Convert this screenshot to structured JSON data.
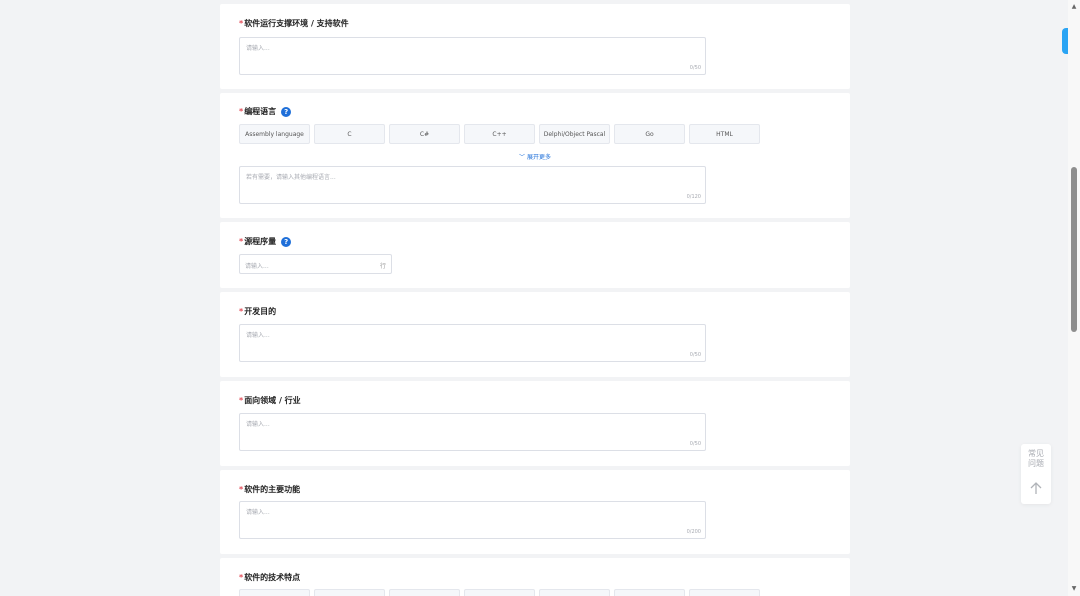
{
  "sections": {
    "env": {
      "title": "软件运行支撑环境 / 支持软件",
      "placeholder": "请输入...",
      "count": "0/50"
    },
    "lang": {
      "title": "编程语言",
      "help": "?",
      "options": [
        "Assembly language",
        "C",
        "C#",
        "C++",
        "Delphi/Object Pascal",
        "Go",
        "HTML"
      ],
      "expand": "展开更多",
      "placeholder": "若有需要，请输入其他编程语言...",
      "count": "0/120"
    },
    "loc": {
      "title": "源程序量",
      "help": "?",
      "placeholder": "请输入...",
      "unit": "行"
    },
    "purpose": {
      "title": "开发目的",
      "placeholder": "请输入...",
      "count": "0/50"
    },
    "domain": {
      "title": "面向领域 / 行业",
      "placeholder": "请输入...",
      "count": "0/50"
    },
    "features": {
      "title": "软件的主要功能",
      "placeholder": "请输入...",
      "count": "0/200"
    },
    "tech": {
      "title": "软件的技术特点"
    }
  },
  "required_mark": "*",
  "float": {
    "faq_line1": "常见",
    "faq_line2": "问题"
  },
  "colors": {
    "accent": "#1e6fd9",
    "required": "#e34d59",
    "side_tab": "#2aa4f4"
  }
}
